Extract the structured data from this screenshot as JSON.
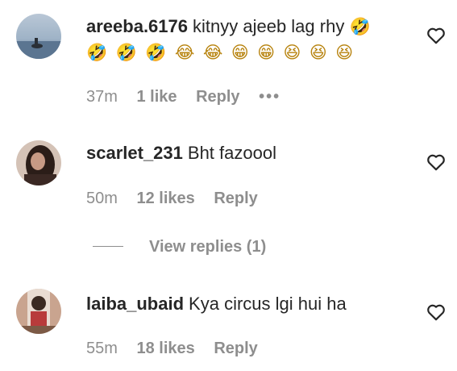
{
  "comments": [
    {
      "username": "areeba.6176",
      "text": "kitnyy ajeeb lag rhy",
      "emoji_inline": "🤣",
      "emoji_row": [
        "🤣",
        "🤣",
        "🤣",
        "😂",
        "😂",
        "😁",
        "😁",
        "😆",
        "😆",
        "😆"
      ],
      "time": "37m",
      "likes": "1 like",
      "reply": "Reply",
      "more": "•••"
    },
    {
      "username": "scarlet_231",
      "text": "Bht fazoool",
      "time": "50m",
      "likes": "12 likes",
      "reply": "Reply"
    },
    {
      "username": "laiba_ubaid",
      "text": "Kya circus lgi hui ha",
      "time": "55m",
      "likes": "18 likes",
      "reply": "Reply"
    }
  ],
  "view_replies": "View replies (1)",
  "icons": {
    "like": "heart-outline-icon",
    "more": "more-options-icon"
  },
  "colors": {
    "text": "#262626",
    "secondary": "#8e8e8e",
    "background": "#ffffff"
  }
}
